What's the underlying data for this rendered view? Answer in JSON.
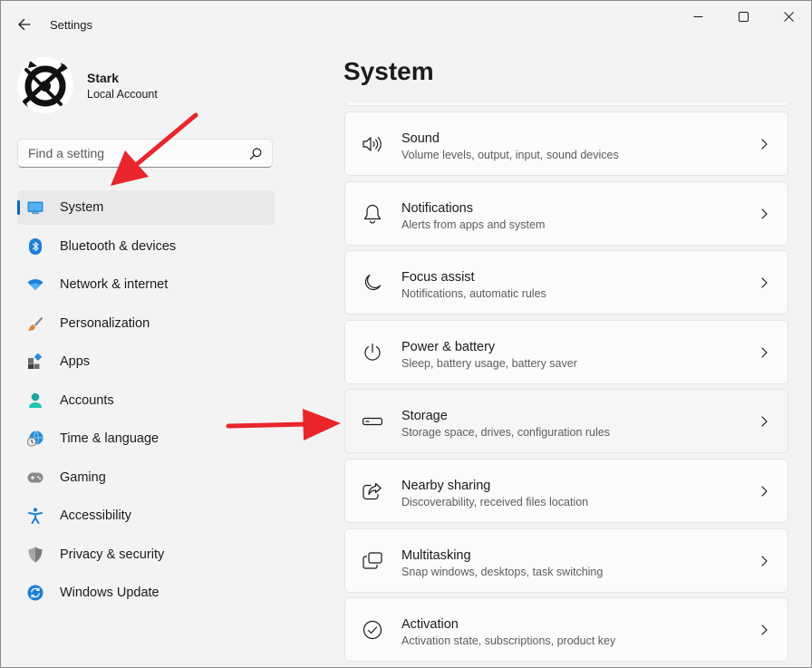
{
  "window": {
    "title": "Settings"
  },
  "account": {
    "name": "Stark",
    "type": "Local Account"
  },
  "search": {
    "placeholder": "Find a setting"
  },
  "nav": {
    "items": [
      {
        "label": "System",
        "icon": "monitor-icon",
        "active": true
      },
      {
        "label": "Bluetooth & devices",
        "icon": "bluetooth-icon"
      },
      {
        "label": "Network & internet",
        "icon": "wifi-icon"
      },
      {
        "label": "Personalization",
        "icon": "brush-icon"
      },
      {
        "label": "Apps",
        "icon": "apps-icon"
      },
      {
        "label": "Accounts",
        "icon": "person-icon"
      },
      {
        "label": "Time & language",
        "icon": "globe-clock-icon"
      },
      {
        "label": "Gaming",
        "icon": "gamepad-icon"
      },
      {
        "label": "Accessibility",
        "icon": "accessibility-icon"
      },
      {
        "label": "Privacy & security",
        "icon": "shield-icon"
      },
      {
        "label": "Windows Update",
        "icon": "update-icon"
      }
    ]
  },
  "main": {
    "title": "System",
    "cards": [
      {
        "title": "Sound",
        "subtitle": "Volume levels, output, input, sound devices",
        "icon": "speaker-icon"
      },
      {
        "title": "Notifications",
        "subtitle": "Alerts from apps and system",
        "icon": "bell-icon"
      },
      {
        "title": "Focus assist",
        "subtitle": "Notifications, automatic rules",
        "icon": "moon-icon"
      },
      {
        "title": "Power & battery",
        "subtitle": "Sleep, battery usage, battery saver",
        "icon": "power-icon"
      },
      {
        "title": "Storage",
        "subtitle": "Storage space, drives, configuration rules",
        "icon": "drive-icon"
      },
      {
        "title": "Nearby sharing",
        "subtitle": "Discoverability, received files location",
        "icon": "share-icon"
      },
      {
        "title": "Multitasking",
        "subtitle": "Snap windows, desktops, task switching",
        "icon": "multitask-icon"
      },
      {
        "title": "Activation",
        "subtitle": "Activation state, subscriptions, product key",
        "icon": "check-circle-icon"
      }
    ]
  },
  "colors": {
    "accent": "#0067c0",
    "annotation_arrow": "#e8262b",
    "background": "#f3f3f3",
    "card": "#fbfbfb"
  }
}
